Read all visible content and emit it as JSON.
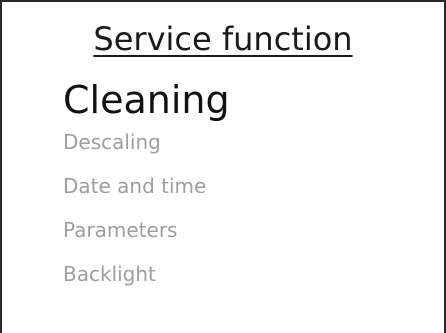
{
  "header": {
    "title": "Service function"
  },
  "menu": {
    "items": [
      {
        "label": "Cleaning",
        "selected": true
      },
      {
        "label": "Descaling",
        "selected": false
      },
      {
        "label": "Date and time",
        "selected": false
      },
      {
        "label": "Parameters",
        "selected": false
      },
      {
        "label": "Backlight",
        "selected": false
      }
    ]
  },
  "colors": {
    "selected_text": "#111111",
    "unselected_text": "#9e9e9e",
    "frame": "#2a2a2a",
    "background": "#ffffff"
  }
}
